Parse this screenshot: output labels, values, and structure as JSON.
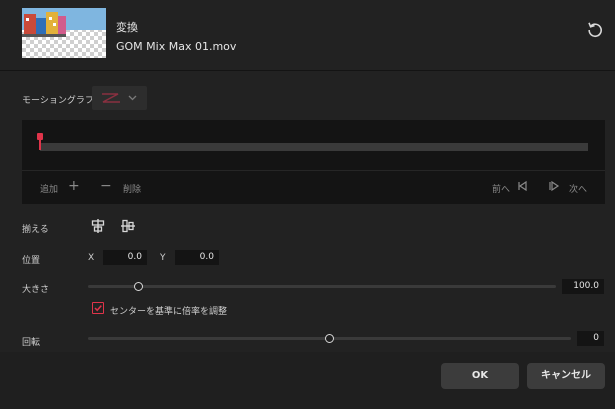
{
  "header": {
    "title": "変換",
    "filename": "GOM Mix Max 01.mov",
    "reset_icon": "rotate-ccw-icon"
  },
  "motion_graph": {
    "label": "モーショングラフ",
    "selected_icon": "z-curve-icon"
  },
  "timeline": {
    "add_label": "追加",
    "delete_label": "削除",
    "prev_label": "前へ",
    "next_label": "次へ",
    "playhead_color": "#e0344a"
  },
  "align": {
    "label": "揃える",
    "icons": [
      "align-horizontal-center-icon",
      "align-vertical-center-icon"
    ]
  },
  "position": {
    "label": "位置",
    "x_label": "X",
    "x_value": "0.0",
    "y_label": "Y",
    "y_value": "0.0"
  },
  "size": {
    "label": "大きさ",
    "value": "100.0",
    "slider_fraction": 0.11
  },
  "center_scale": {
    "checked": true,
    "label": "センターを基準に倍率を調整"
  },
  "rotation": {
    "label": "回転",
    "value": "0",
    "slider_fraction": 0.5
  },
  "buttons": {
    "ok": "OK",
    "cancel": "キャンセル"
  },
  "colors": {
    "accent": "#e0344a",
    "background": "#222222"
  }
}
